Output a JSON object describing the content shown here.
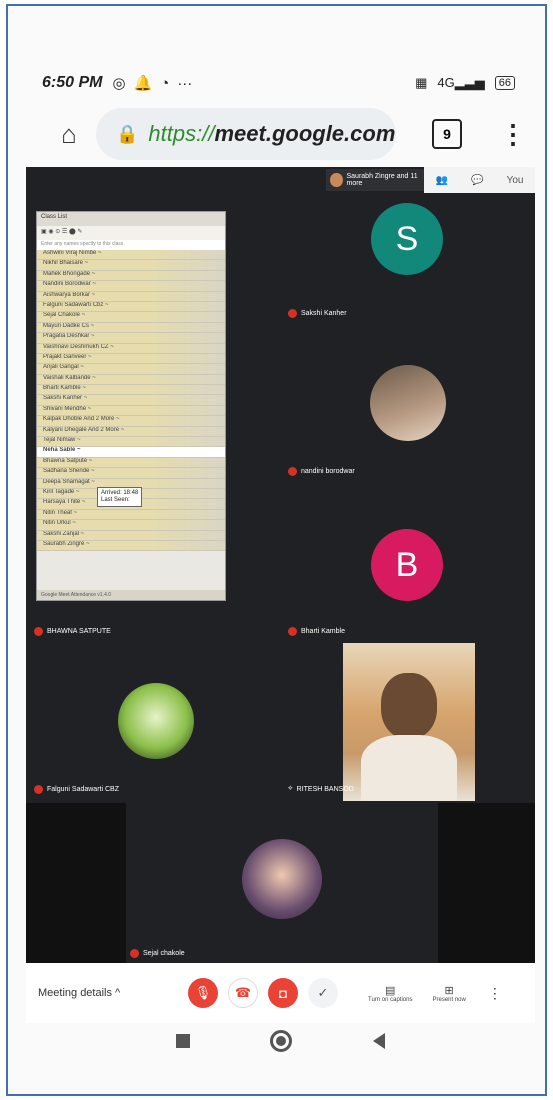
{
  "status_bar": {
    "time": "6:50 PM",
    "more": "···",
    "network": "4G",
    "battery": "66"
  },
  "browser": {
    "url_scheme": "https://",
    "url_host": "meet.google.com",
    "tab_count": "9"
  },
  "meet": {
    "top_participants": "Saurabh Zingre and 11 more",
    "top_you_label": "You",
    "tiles": {
      "sakshi": {
        "name": "Sakshi Kanher",
        "initial": "S",
        "color": "#12887a"
      },
      "nandini": {
        "name": "nandini borodwar"
      },
      "bharti": {
        "name": "Bharti Kamble",
        "initial": "B",
        "color": "#d81b60"
      },
      "bhawna": {
        "name": "BHAWNA SATPUTE"
      },
      "falguni": {
        "name": "Falguni Sadawarti CBZ"
      },
      "ritesh": {
        "name": "RITESH BANSOD"
      },
      "sejal": {
        "name": "Sejal chakole"
      }
    },
    "class_list": {
      "title": "Class List",
      "search_hint": "Enter any names specify to this class",
      "rows": [
        "Ashwini Viraj Nimbe ~",
        "Nikhil Bhaisare ~",
        "Mahek Bhongade ~",
        "Nandini Borodwar ~",
        "Aishwarya Borkar ~",
        "Falguni Sadawarti Cbz ~",
        "Sejal Chakole ~",
        "Mayuri Dadke Cs ~",
        "Pragatia Deshkar ~",
        "Vaishnavi Deshmukh CZ ~",
        "Prajakt Ganveer ~",
        "Anjali Gangal ~",
        "Vaishali Kalbande ~",
        "Bharti Kamble ~",
        "Sakshi Kanher ~",
        "Shivani Mendhe ~",
        "Kalpak Dhoble And 2 More ~",
        "Kalyani Dhegale And 2 More ~",
        "Tejal Nimaw ~",
        "Neha Sable ~",
        "Bhawna Satpute ~",
        "Sadhana Shende ~",
        "Deepa Shamagat ~",
        "Kiril Tagade ~",
        "Harsaya Thite ~",
        "Nitin Theaf ~",
        "Nitin Urkul ~",
        "Sakshi Zanjal ~",
        "Saurabh Zingre ~"
      ],
      "tooltip_arrived": "Arrived: 18:48",
      "tooltip_last": "Last Seen:",
      "footer": "Google Meet Attendance v1.4.0"
    }
  },
  "controls": {
    "meeting_details": "Meeting details",
    "captions": "Turn on captions",
    "present": "Present now"
  }
}
